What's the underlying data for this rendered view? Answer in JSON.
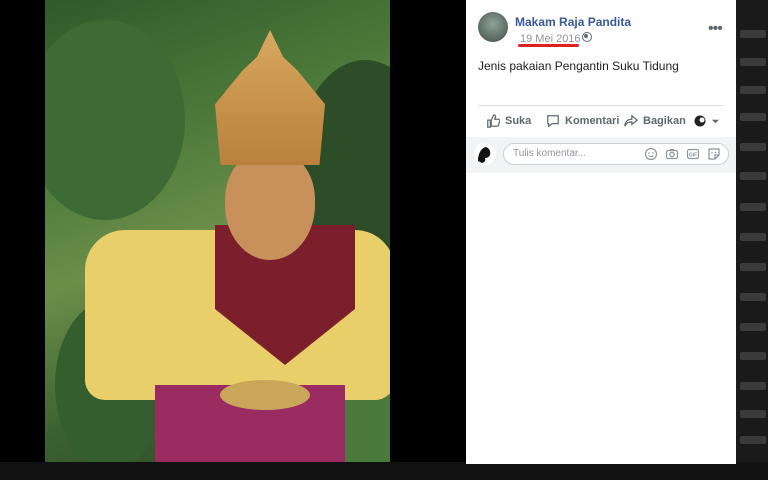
{
  "post": {
    "author": "Makam Raja Pandita",
    "date": "19 Mei 2016",
    "date_separator": "·",
    "privacy_icon": "globe-icon",
    "text": "Jenis pakaian Pengantin Suku Tidung",
    "more_icon": "more-options-icon"
  },
  "actions": {
    "like": "Suka",
    "comment": "Komentari",
    "share": "Bagikan"
  },
  "comment": {
    "placeholder": "Tulis komentar...",
    "icons": [
      "emoji-icon",
      "camera-icon",
      "gif-icon",
      "sticker-icon"
    ]
  },
  "colors": {
    "link": "#385898",
    "muted": "#90949c",
    "highlight_underline": "#e02020"
  }
}
